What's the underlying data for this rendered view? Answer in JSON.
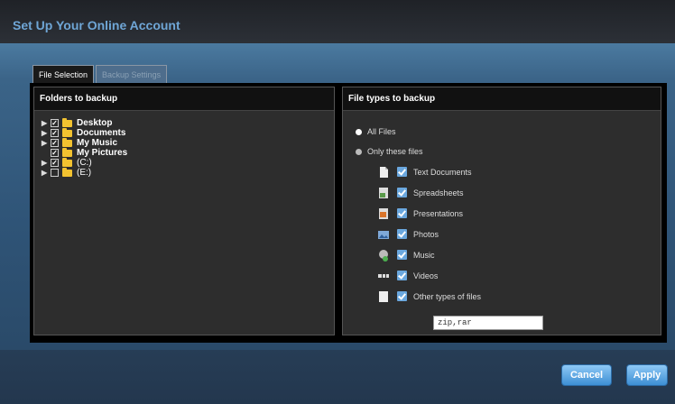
{
  "window": {
    "title": "Set Up Your Online Account"
  },
  "tabs": [
    {
      "label": "File Selection",
      "active": true
    },
    {
      "label": "Backup Settings",
      "active": false
    }
  ],
  "folders_panel": {
    "header": "Folders to backup",
    "items": [
      {
        "label": "Desktop",
        "checked": true,
        "expandable": true
      },
      {
        "label": "Documents",
        "checked": true,
        "expandable": true
      },
      {
        "label": "My Music",
        "checked": true,
        "expandable": true
      },
      {
        "label": "My Pictures",
        "checked": true,
        "expandable": false
      },
      {
        "label": "(C:)",
        "checked": true,
        "expandable": true
      },
      {
        "label": "(E:)",
        "checked": false,
        "expandable": true
      }
    ]
  },
  "types_panel": {
    "header": "File types to backup",
    "all_files_label": "All Files",
    "only_these_label": "Only these files",
    "selected_option": "only_these",
    "types": [
      {
        "label": "Text Documents",
        "icon": "text-document-icon",
        "checked": true
      },
      {
        "label": "Spreadsheets",
        "icon": "spreadsheet-icon",
        "checked": true
      },
      {
        "label": "Presentations",
        "icon": "presentation-icon",
        "checked": true
      },
      {
        "label": "Photos",
        "icon": "photo-icon",
        "checked": true
      },
      {
        "label": "Music",
        "icon": "music-icon",
        "checked": true
      },
      {
        "label": "Videos",
        "icon": "video-icon",
        "checked": true
      },
      {
        "label": "Other types of files",
        "icon": "other-file-icon",
        "checked": true
      }
    ],
    "other_types_value": "zip,rar"
  },
  "buttons": {
    "cancel": "Cancel",
    "apply": "Apply"
  },
  "colors": {
    "accent": "#6aa7de",
    "title": "#6fa6d6",
    "folder": "#f2c230"
  }
}
